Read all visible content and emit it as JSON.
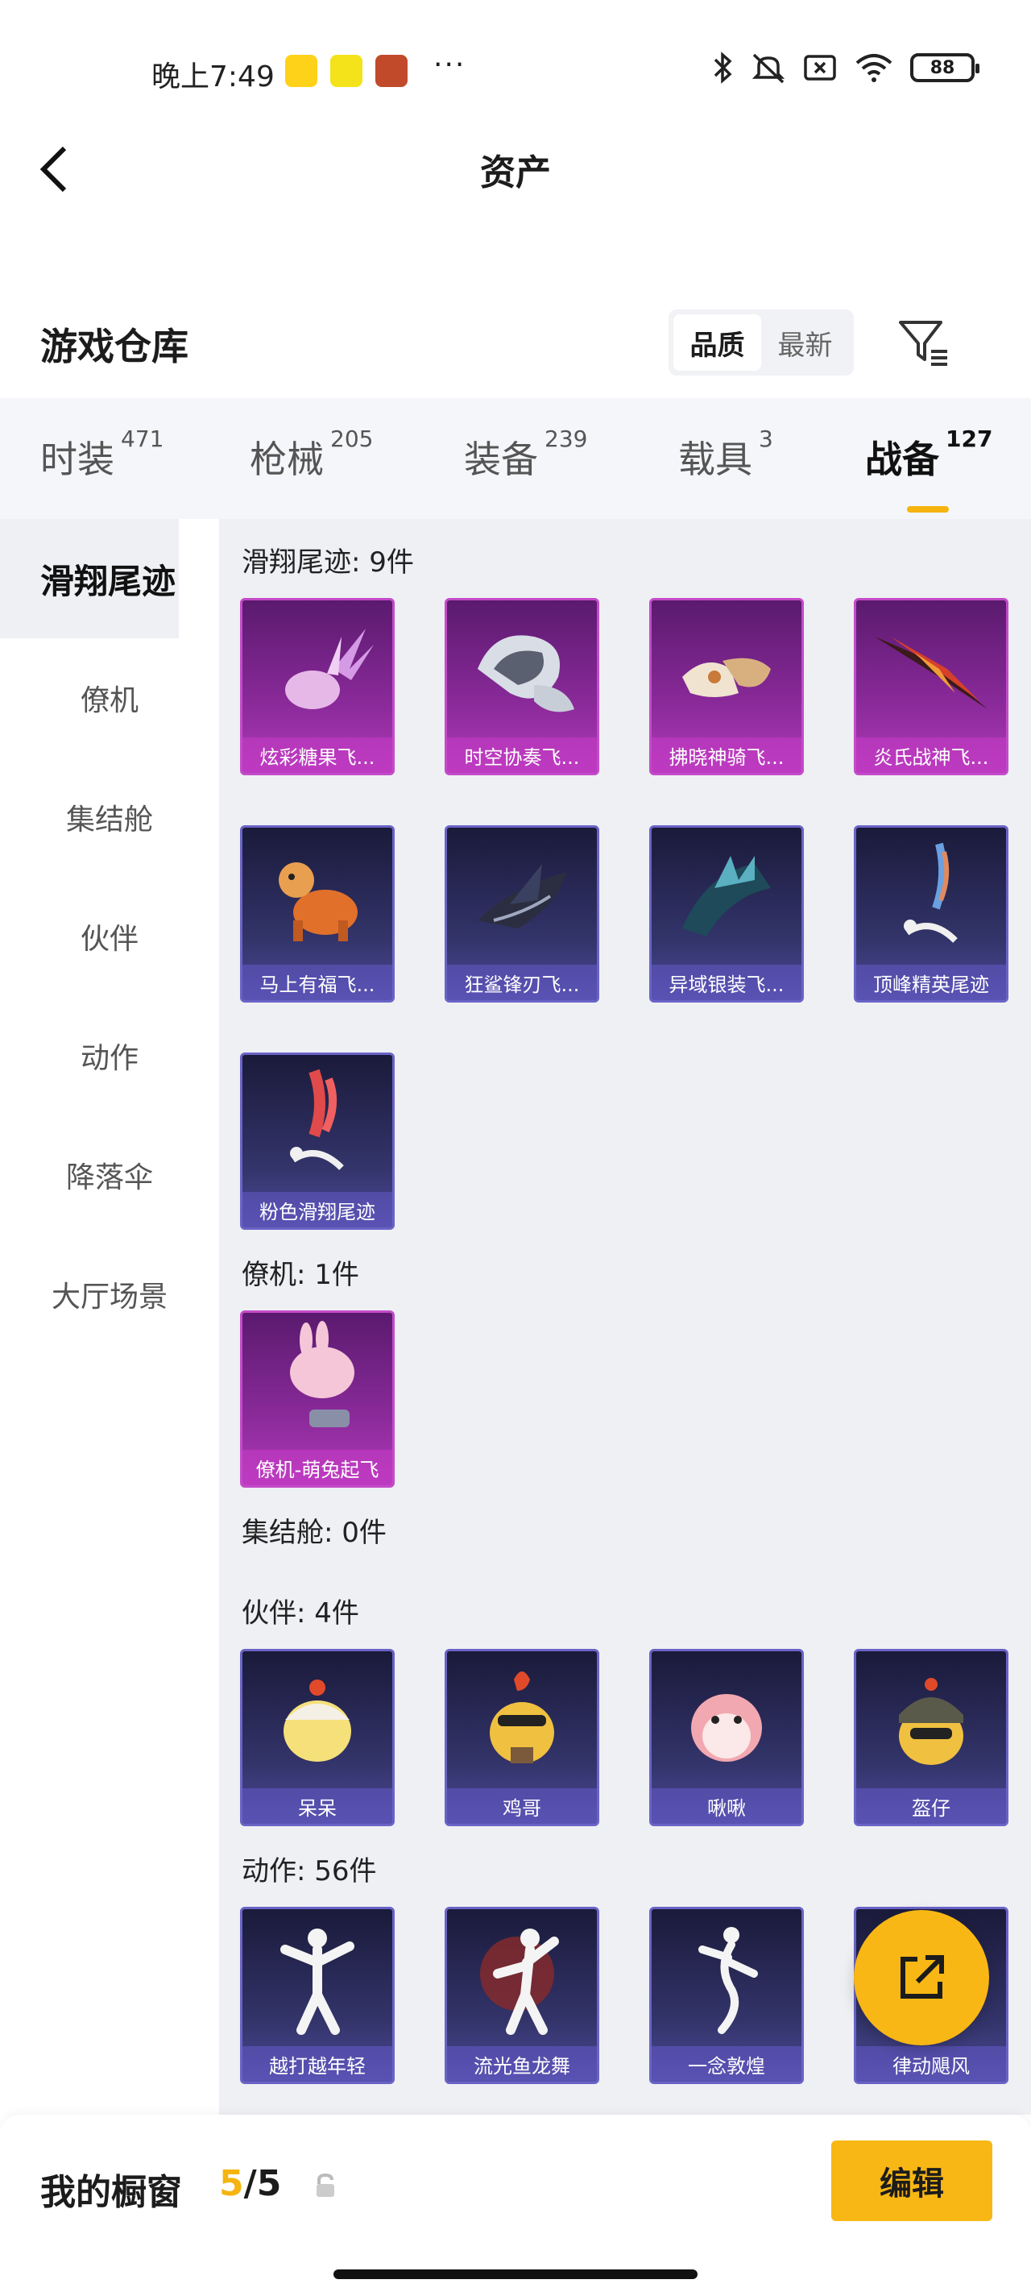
{
  "status_bar": {
    "time": "晚上7:49",
    "more": "···",
    "battery": "88"
  },
  "header": {
    "title": "资产"
  },
  "warehouse": {
    "title": "游戏仓库",
    "sort_options": [
      "品质",
      "最新"
    ],
    "active_sort": "品质"
  },
  "categories": [
    {
      "label": "时装",
      "count": "471"
    },
    {
      "label": "枪械",
      "count": "205"
    },
    {
      "label": "装备",
      "count": "239"
    },
    {
      "label": "载具",
      "count": "3"
    },
    {
      "label": "战备",
      "count": "127"
    }
  ],
  "active_category": "战备",
  "sidebar": [
    "滑翔尾迹",
    "僚机",
    "集结舱",
    "伙伴",
    "动作",
    "降落伞",
    "大厅场景"
  ],
  "active_sidebar": "滑翔尾迹",
  "sections": {
    "glide": {
      "title": "滑翔尾迹: 9件",
      "items": [
        "炫彩糖果飞...",
        "时空协奏飞...",
        "拂晓神骑飞...",
        "炎氏战神飞...",
        "马上有福飞...",
        "狂鲨锋刃飞...",
        "异域银装飞...",
        "顶峰精英尾迹",
        "粉色滑翔尾迹"
      ]
    },
    "wingman": {
      "title": "僚机: 1件",
      "items": [
        "僚机-萌兔起飞"
      ]
    },
    "capsule": {
      "title": "集结舱: 0件"
    },
    "partner": {
      "title": "伙伴: 4件",
      "items": [
        "呆呆",
        "鸡哥",
        "啾啾",
        "盔仔"
      ]
    },
    "action": {
      "title": "动作: 56件",
      "items": [
        "越打越年轻",
        "流光鱼龙舞",
        "一念敦煌",
        "律动飓风"
      ]
    }
  },
  "bottom_bar": {
    "label": "我的橱窗",
    "current": "5",
    "separator": "/",
    "total": "5",
    "edit_label": "编辑"
  },
  "colors": {
    "accent": "#f8b714",
    "purple_rarity": "#b23ab8",
    "blue_rarity": "#4c4a9a"
  }
}
